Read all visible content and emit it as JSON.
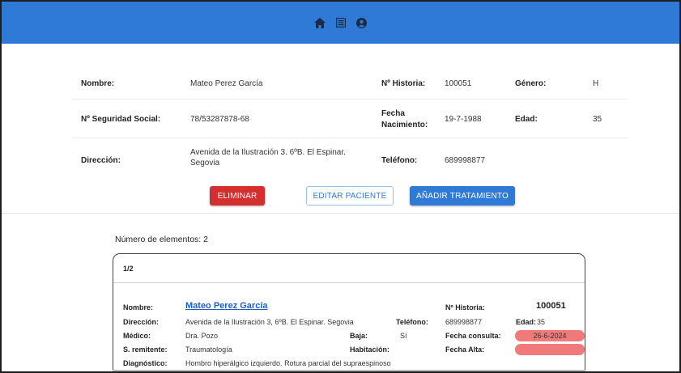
{
  "nav": {
    "icons": [
      "home-icon",
      "list-icon",
      "account-icon"
    ]
  },
  "patient": {
    "nombre_label": "Nombre:",
    "nombre": "Mateo Perez García",
    "historia_label": "Nº Historia:",
    "historia": "100051",
    "genero_label": "Género:",
    "genero": "H",
    "nss_label": "Nº Seguridad Social:",
    "nss": "78/53287878-68",
    "fecha_nac_label_1": "Fecha",
    "fecha_nac_label_2": "Nacimiento:",
    "fecha_nac": "19-7-1988",
    "edad_label": "Edad:",
    "edad": "35",
    "direccion_label": "Dirección:",
    "direccion_1": "Avenida de la Ilustración 3. 6ºB. El Espinar.",
    "direccion_2": "Segovia",
    "telefono_label": "Teléfono:",
    "telefono": "689998877"
  },
  "actions": {
    "eliminar": "ELIMINAR",
    "editar": "EDITAR PACIENTE",
    "anadir": "AÑADIR TRATAMIENTO"
  },
  "list": {
    "count_text": "Número de elementos: 2"
  },
  "card": {
    "pager": "1/2",
    "nombre_label": "Nombre:",
    "nombre": "Mateo Perez García",
    "historia_label": "Nº Historia:",
    "historia": "100051",
    "direccion_label": "Dirección:",
    "direccion": "Avenida de la Ilustración 3, 6ºB. El Espinar. Segovia",
    "telefono_label": "Teléfono:",
    "telefono": "689998877",
    "edad_label": "Edad:",
    "edad": "35",
    "medico_label": "Médico:",
    "medico": "Dra. Pozo",
    "baja_label": "Baja:",
    "baja": "Sí",
    "fecha_consulta_label": "Fecha consulta:",
    "fecha_consulta": "26-6-2024",
    "remitente_label": "S. remitente:",
    "remitente": "Traumatología",
    "habitacion_label": "Habitación:",
    "fecha_alta_label": "Fecha Alta:",
    "fecha_alta": "",
    "diagnostico_label": "Diagnóstico:",
    "diagnostico": "Hombro hiperálgico izquierdo. Rotura parcial del supraespinoso"
  },
  "colors": {
    "appbar": "#2f7ad7",
    "danger": "#d32f2f",
    "pill": "#f07a7a"
  }
}
